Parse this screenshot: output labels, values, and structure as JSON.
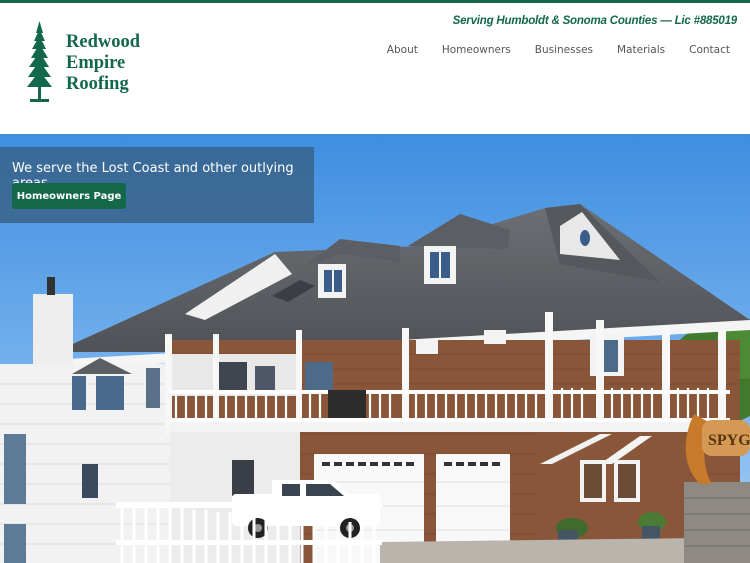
{
  "brand": {
    "line1": "Redwood",
    "line2": "Empire",
    "line3": "Roofing",
    "color": "#13684a"
  },
  "tagline": "Serving Humboldt & Sonoma Counties — Lic #885019",
  "nav": {
    "items": [
      "About",
      "Homeowners",
      "Businesses",
      "Materials",
      "Contact"
    ]
  },
  "hero": {
    "message": "We serve the Lost Coast and other outlying areas.",
    "button_label": "Homeowners Page",
    "sign_text": "SPYG"
  },
  "icons": {
    "logo": "redwood-tree-icon"
  }
}
